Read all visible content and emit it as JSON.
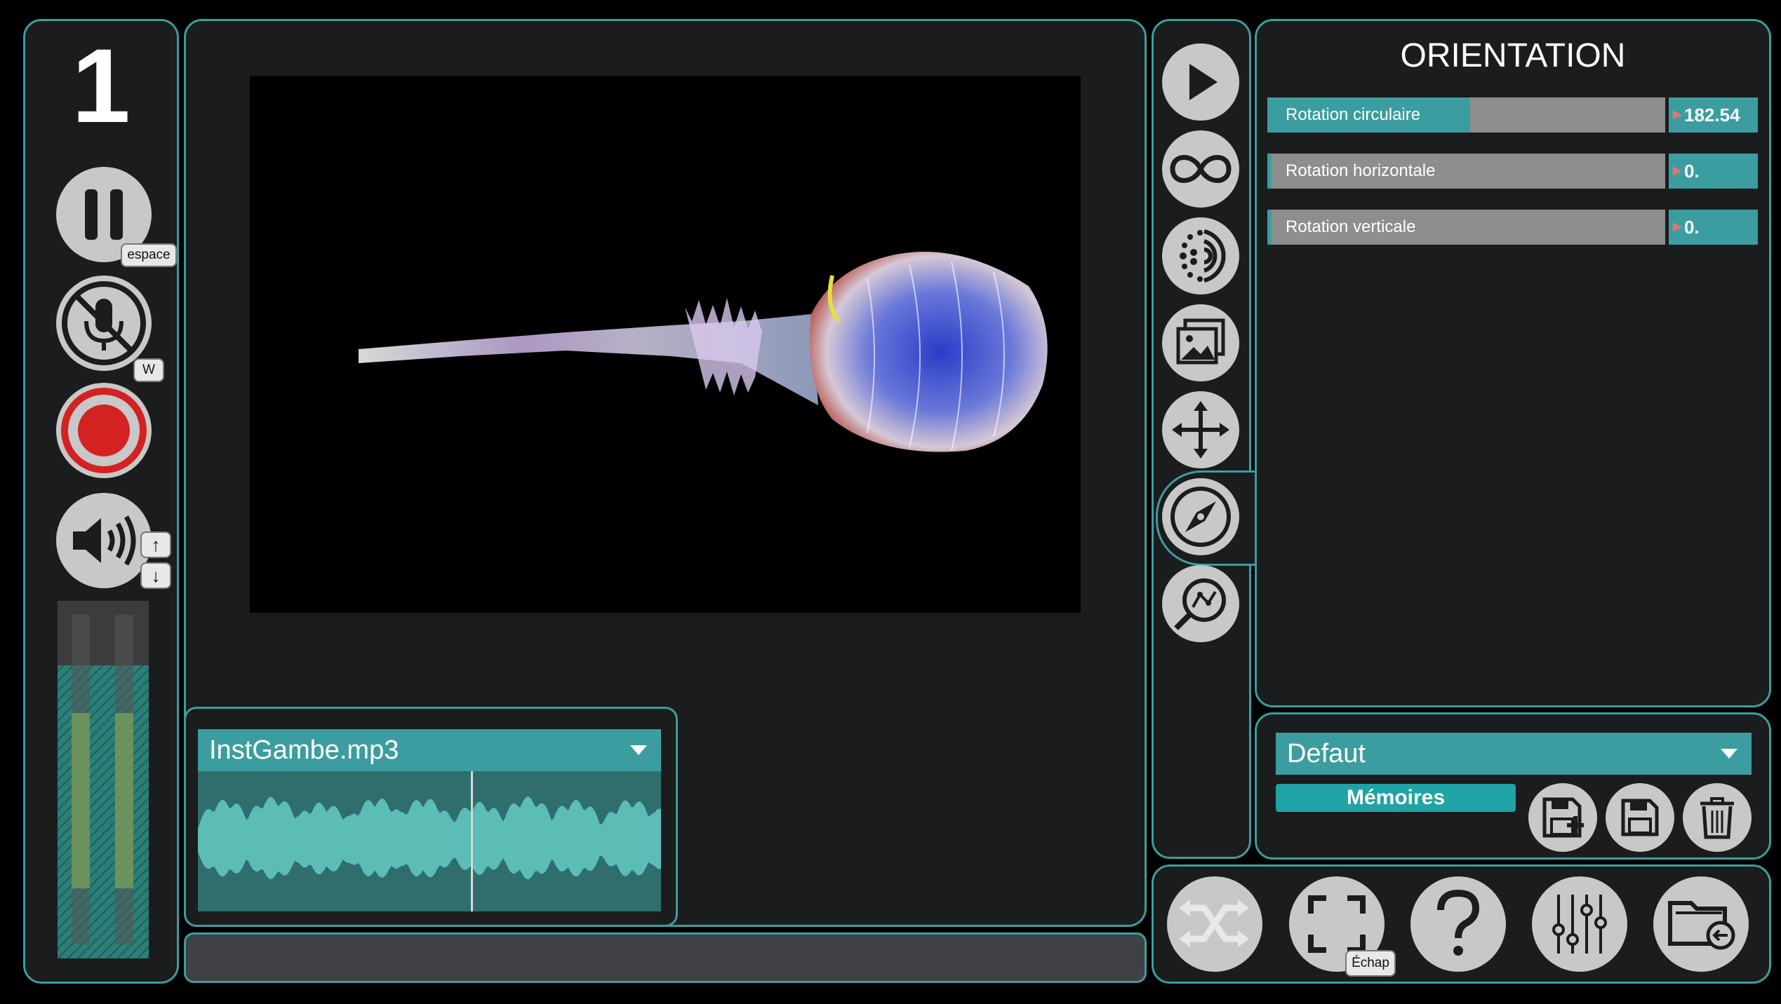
{
  "left_panel": {
    "track_number": "1",
    "pause_key": "espace",
    "mic_key": "W",
    "volume_up_key": "↑",
    "volume_down_key": "↓",
    "icons": [
      "pause-icon",
      "microphone-muted-icon",
      "record-icon",
      "speaker-icon"
    ]
  },
  "player": {
    "filename": "InstGambe.mp3",
    "playhead_fraction": 0.59
  },
  "tool_icons": [
    "play-icon",
    "infinity-icon",
    "particles-icon",
    "image-icon",
    "move-icon",
    "compass-icon",
    "zoom-curve-icon"
  ],
  "orientation": {
    "title": "ORIENTATION",
    "sliders": [
      {
        "label": "Rotation circulaire",
        "value": "182.54",
        "fraction": 0.51
      },
      {
        "label": "Rotation horizontale",
        "value": "0.",
        "fraction": 0.0
      },
      {
        "label": "Rotation verticale",
        "value": "0.",
        "fraction": 0.0
      }
    ]
  },
  "presets": {
    "selected": "Defaut",
    "memories_label": "Mémoires"
  },
  "bottom_buttons": {
    "fullscreen_key": "Échap",
    "icons": [
      "shuffle-icon",
      "fullscreen-icon",
      "help-icon",
      "mixer-icon",
      "folder-open-icon"
    ]
  },
  "colors": {
    "accent": "#3c9da0",
    "panel": "#1b1c1d",
    "button": "#c8c8c8",
    "record": "#d42222"
  }
}
